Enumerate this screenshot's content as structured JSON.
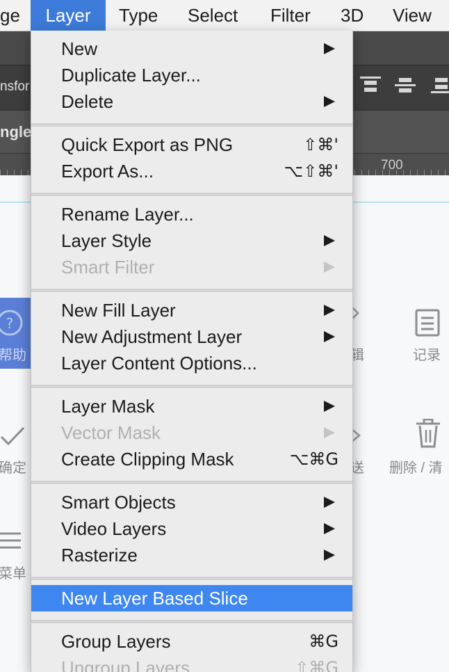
{
  "menubar": {
    "items": [
      {
        "label": "ge"
      },
      {
        "label": "Layer"
      },
      {
        "label": "Type"
      },
      {
        "label": "Select"
      },
      {
        "label": "Filter"
      },
      {
        "label": "3D"
      },
      {
        "label": "View"
      }
    ],
    "active_color": "#3c7bd9"
  },
  "background": {
    "options_text": "nsfor",
    "tab_text": "ngle",
    "ruler_label": "700",
    "labels": {
      "help": "帮助",
      "edit_partial": "辑",
      "record": "记录",
      "confirm": "确定",
      "send_partial": "送",
      "delete_clear": "删除 / 清",
      "menu": "菜单"
    },
    "icons": [
      "help-icon",
      "chevron-right-icon",
      "document-icon",
      "checkmark-icon",
      "trash-icon",
      "hamburger-icon"
    ]
  },
  "layer_menu": {
    "items": [
      {
        "label": "New",
        "submenu": true
      },
      {
        "label": "Duplicate Layer..."
      },
      {
        "label": "Delete",
        "submenu": true
      },
      {
        "label": "Quick Export as PNG",
        "shortcut": "⇧⌘'"
      },
      {
        "label": "Export As...",
        "shortcut": "⌥⇧⌘'"
      },
      {
        "label": "Rename Layer..."
      },
      {
        "label": "Layer Style",
        "submenu": true
      },
      {
        "label": "Smart Filter",
        "submenu": true,
        "disabled": true
      },
      {
        "label": "New Fill Layer",
        "submenu": true
      },
      {
        "label": "New Adjustment Layer",
        "submenu": true
      },
      {
        "label": "Layer Content Options..."
      },
      {
        "label": "Layer Mask",
        "submenu": true
      },
      {
        "label": "Vector Mask",
        "submenu": true,
        "disabled": true
      },
      {
        "label": "Create Clipping Mask",
        "shortcut": "⌥⌘G"
      },
      {
        "label": "Smart Objects",
        "submenu": true
      },
      {
        "label": "Video Layers",
        "submenu": true
      },
      {
        "label": "Rasterize",
        "submenu": true
      },
      {
        "label": "New Layer Based Slice",
        "highlighted": true
      },
      {
        "label": "Group Layers",
        "shortcut": "⌘G"
      },
      {
        "label": "Ungroup Layers",
        "shortcut": "⇧⌘G",
        "disabled": true
      }
    ],
    "highlight_color": "#3e86f0"
  }
}
